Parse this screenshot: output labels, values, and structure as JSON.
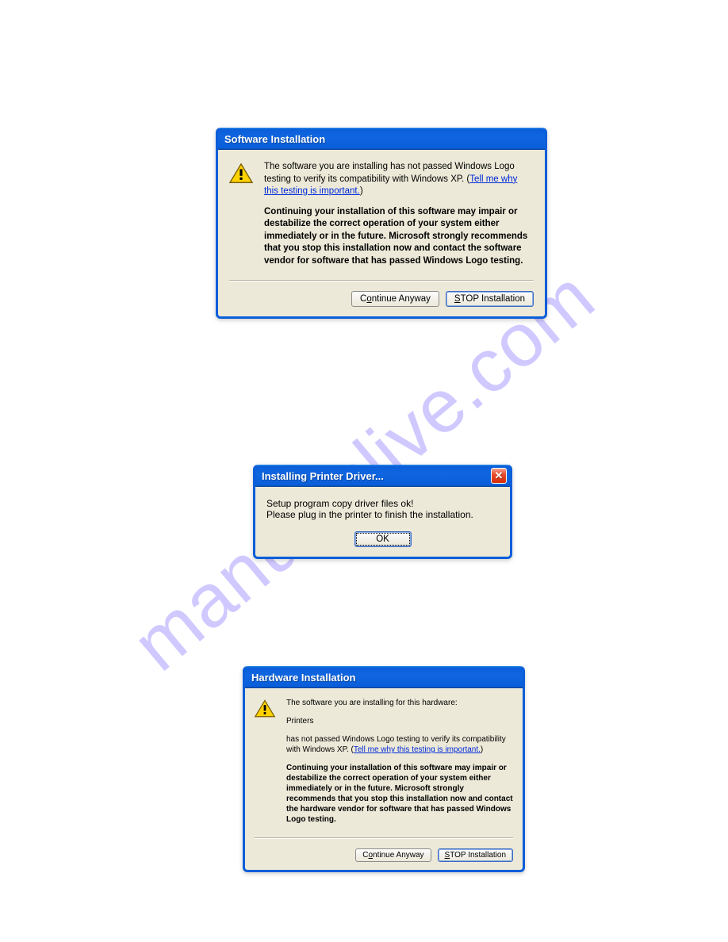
{
  "watermark": "manualslive.com",
  "dialog1": {
    "title": "Software Installation",
    "message1_pre": "The software you are installing has not passed Windows Logo testing to verify its compatibility with Windows XP. (",
    "message1_link": "Tell me why this testing is important.",
    "message1_post": ")",
    "message2": "Continuing your installation of this software may impair or destabilize the correct operation of your system either immediately or in the future. Microsoft strongly recommends that you stop this installation now and contact the software vendor for software that has passed Windows Logo testing.",
    "btn_continue_pre": "C",
    "btn_continue_ul": "o",
    "btn_continue_post": "ntinue Anyway",
    "btn_stop_ul": "S",
    "btn_stop_post": "TOP Installation"
  },
  "dialog2": {
    "title": "Installing Printer Driver...",
    "line1": "Setup program copy driver files ok!",
    "line2": "Please plug in the printer to finish the installation.",
    "btn_ok": "OK"
  },
  "dialog3": {
    "title": "Hardware Installation",
    "line1": "The software you are installing for this hardware:",
    "line2": "Printers",
    "line3_pre": "has not passed Windows Logo testing to verify its compatibility with Windows XP. (",
    "line3_link": "Tell me why this testing is important.",
    "line3_post": ")",
    "line4": "Continuing your installation of this software may impair or destabilize the correct operation of your system either immediately or in the future. Microsoft strongly recommends that you stop this installation now and contact the hardware vendor for software that has passed Windows Logo testing.",
    "btn_continue_pre": "C",
    "btn_continue_ul": "o",
    "btn_continue_post": "ntinue Anyway",
    "btn_stop_ul": "S",
    "btn_stop_post": "TOP Installation"
  }
}
